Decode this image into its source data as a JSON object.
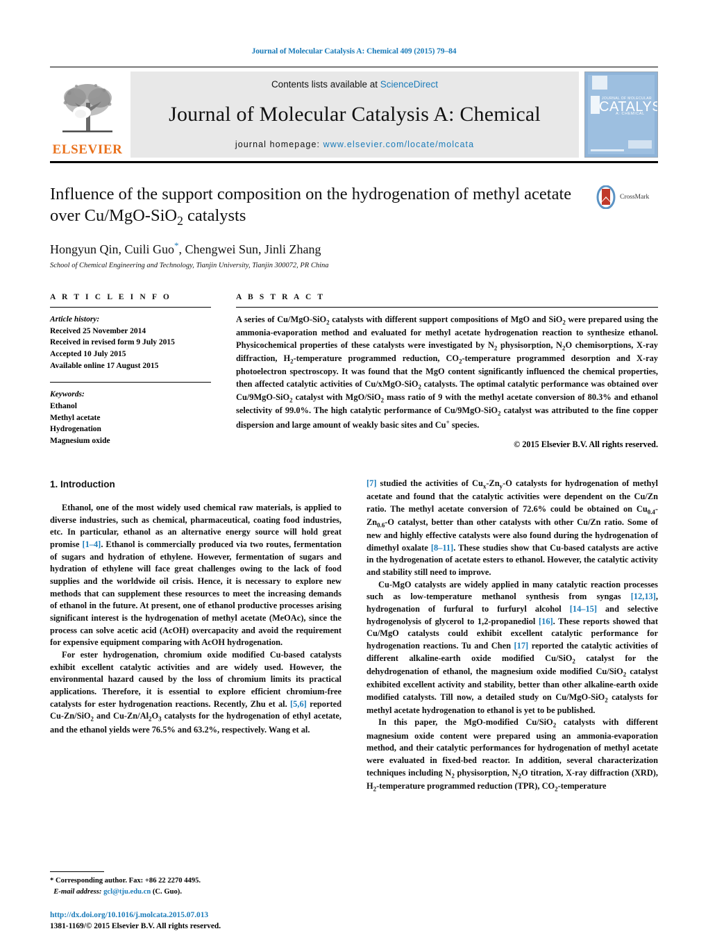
{
  "running_head": "Journal of Molecular Catalysis A: Chemical 409 (2015) 79–84",
  "masthead": {
    "contents_prefix": "Contents lists available at ",
    "contents_link": "ScienceDirect",
    "journal_title": "Journal of Molecular Catalysis A: Chemical",
    "homepage_prefix": "journal homepage: ",
    "homepage_url": "www.elsevier.com/locate/molcata",
    "publisher": "ELSEVIER",
    "cover": {
      "title": "CATALYSIS",
      "overline": "JOURNAL OF MOLECULAR",
      "subtitle": "A: CHEMICAL"
    }
  },
  "article": {
    "title_line1": "Influence of the support composition on the hydrogenation of methyl",
    "title_line2_pre": "acetate over Cu/MgO-SiO",
    "title_line2_sub": "2",
    "title_line2_post": " catalysts",
    "authors_pre": "Hongyun Qin, Cuili Guo",
    "authors_star": "*",
    "authors_post": ", Chengwei Sun, Jinli Zhang",
    "affiliation": "School of Chemical Engineering and Technology, Tianjin University, Tianjin 300072, PR China",
    "crossmark_label": "CrossMark"
  },
  "info": {
    "heading": "A R T I C L E   I N F O",
    "history_label": "Article history:",
    "history": [
      "Received 25 November 2014",
      "Received in revised form 9 July 2015",
      "Accepted 10 July 2015",
      "Available online 17 August 2015"
    ],
    "keywords_label": "Keywords:",
    "keywords": [
      "Ethanol",
      "Methyl acetate",
      "Hydrogenation",
      "Magnesium oxide"
    ]
  },
  "abstract": {
    "heading": "A B S T R A C T",
    "copyright": "© 2015 Elsevier B.V. All rights reserved."
  },
  "sections": {
    "intro_heading": "1.  Introduction"
  },
  "footnote": {
    "corresponding": "*  Corresponding author. Fax: +86 22 2270 4495.",
    "email_label": "E-mail address:",
    "email": "gcl@tju.edu.cn",
    "email_suffix": " (C. Guo)."
  },
  "footer": {
    "doi": "http://dx.doi.org/10.1016/j.molcata.2015.07.013",
    "issn": "1381-1169/© 2015 Elsevier B.V. All rights reserved."
  },
  "colors": {
    "link": "#1a7bb9",
    "elsevier_orange": "#E9711C",
    "masthead_grey": "#e8e8e8",
    "cover_blue": "#9dbfe0"
  }
}
